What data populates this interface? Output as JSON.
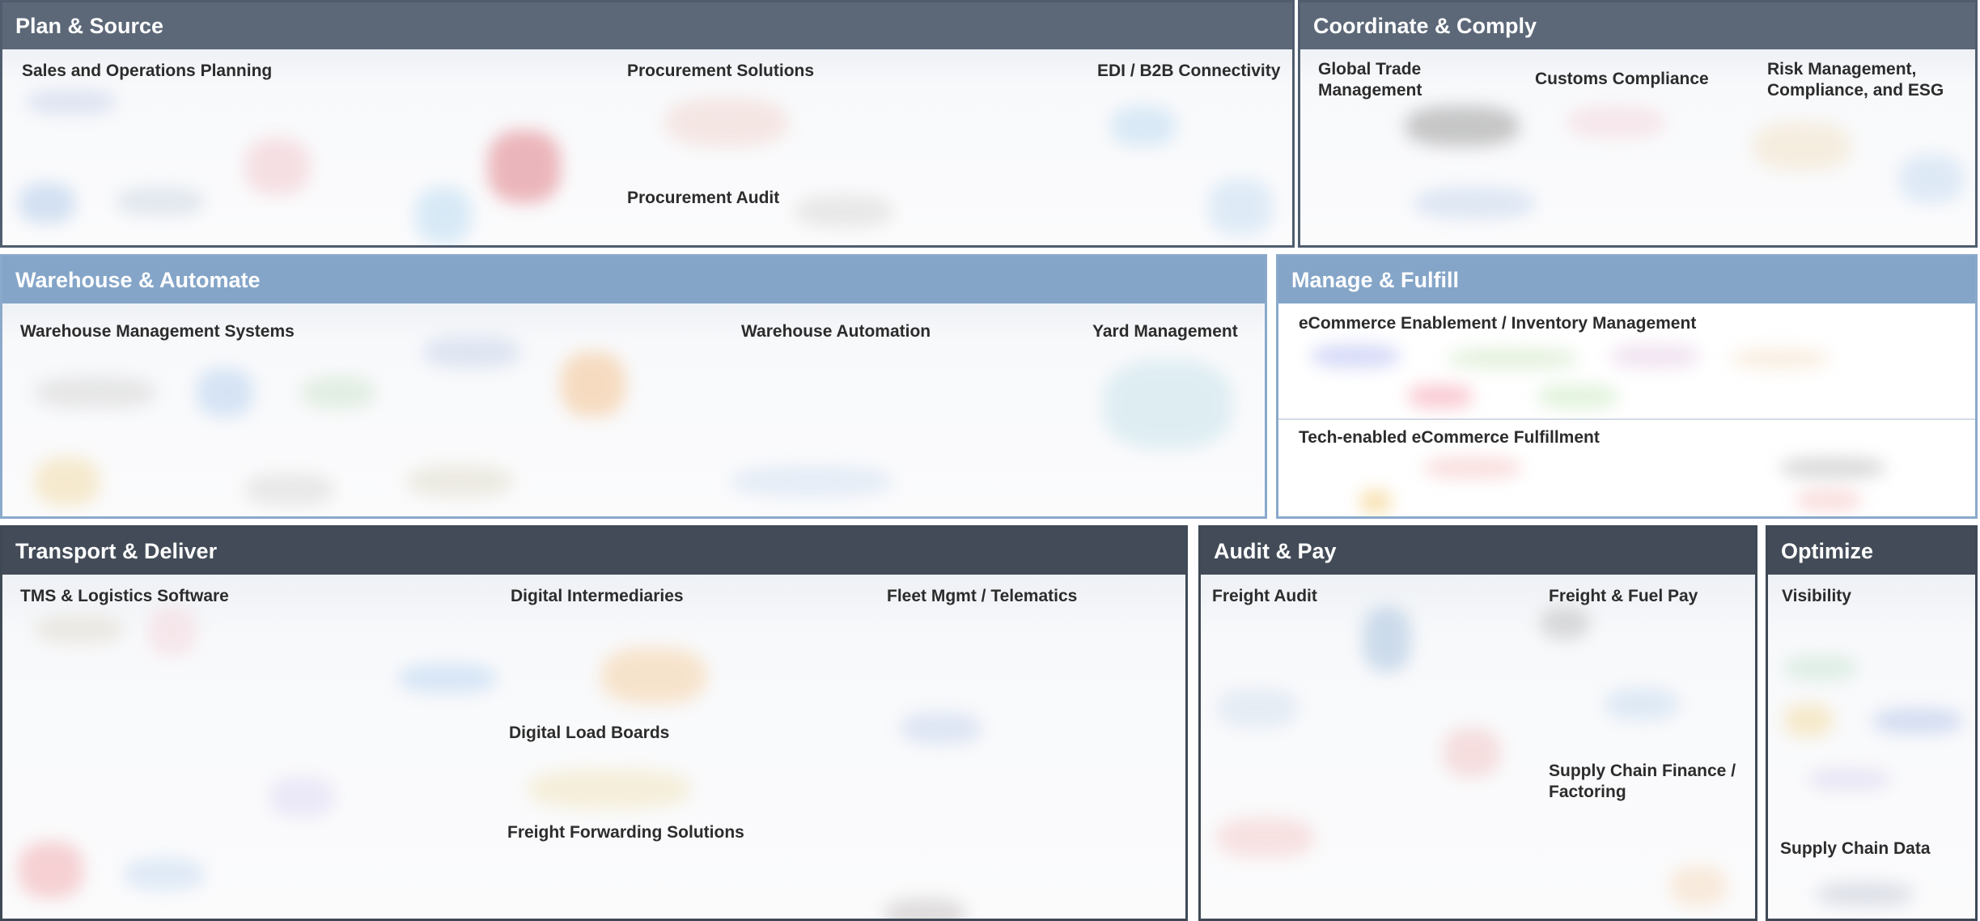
{
  "sections": {
    "plan_source": {
      "title": "Plan & Source",
      "categories": {
        "sop": "Sales and Operations Planning",
        "procurement": "Procurement Solutions",
        "edi": "EDI / B2B Connectivity",
        "audit": "Procurement Audit"
      }
    },
    "coordinate_comply": {
      "title": "Coordinate & Comply",
      "categories": {
        "gtm": "Global Trade Management",
        "customs": "Customs Compliance",
        "risk": "Risk Management, Compliance, and ESG"
      }
    },
    "warehouse_automate": {
      "title": "Warehouse & Automate",
      "categories": {
        "wms": "Warehouse Management Systems",
        "automation": "Warehouse Automation",
        "yard": "Yard Management"
      }
    },
    "manage_fulfill": {
      "title": "Manage & Fulfill",
      "categories": {
        "ecom": "eCommerce Enablement / Inventory Management",
        "fulfillment": "Tech-enabled eCommerce Fulfillment"
      }
    },
    "transport_deliver": {
      "title": "Transport & Deliver",
      "categories": {
        "tms": "TMS & Logistics Software",
        "intermediaries": "Digital Intermediaries",
        "fleet": "Fleet Mgmt / Telematics",
        "load_boards": "Digital Load Boards",
        "forwarding": "Freight Forwarding Solutions"
      }
    },
    "audit_pay": {
      "title": "Audit & Pay",
      "categories": {
        "freight_audit": "Freight Audit",
        "fuel_pay": "Freight & Fuel Pay",
        "finance": "Supply Chain Finance / Factoring"
      }
    },
    "optimize": {
      "title": "Optimize",
      "categories": {
        "visibility": "Visibility",
        "data": "Supply Chain Data"
      }
    }
  }
}
